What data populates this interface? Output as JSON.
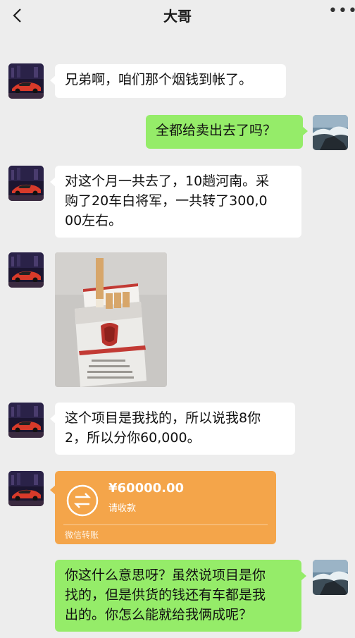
{
  "header": {
    "title": "大哥"
  },
  "messages": [
    {
      "side": "left",
      "text": "兄弟啊，咱们那个烟钱到帐了。"
    },
    {
      "side": "right",
      "text": "全都给卖出去了吗？"
    },
    {
      "side": "left",
      "lines": [
        "对这个月一共去了，10趟河南。采",
        "购了20车白将军，一共转了300,0",
        "00左右。"
      ]
    },
    {
      "side": "left",
      "type": "image",
      "image_label": "cigarette-pack-photo"
    },
    {
      "side": "left",
      "lines": [
        "这个项目是我找的，所以说我8你",
        "2，所以分你60,000。"
      ]
    },
    {
      "side": "left",
      "type": "transfer",
      "amount": "¥60000.00",
      "status": "请收款",
      "footer": "微信转账"
    },
    {
      "side": "right",
      "lines": [
        "你这什么意思呀？虽然说项目是你",
        "找的，但是供货的钱还有车都是我",
        "出的。你怎么能就给我俩成呢？"
      ]
    }
  ],
  "colors": {
    "background": "#ededed",
    "bubble_self": "#95ec69",
    "bubble_other": "#ffffff",
    "transfer": "#f4a54a"
  }
}
